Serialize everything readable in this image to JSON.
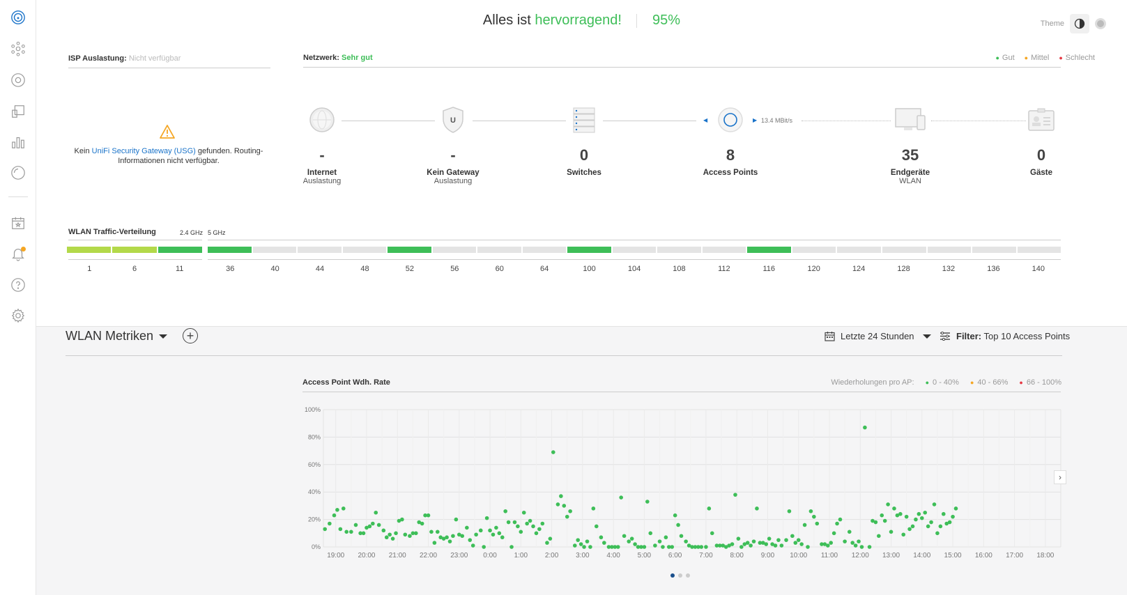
{
  "header": {
    "headline_prefix": "Alles ist",
    "headline_status": "hervorragend!",
    "score": "95%",
    "theme_label": "Theme"
  },
  "isp": {
    "title": "ISP Auslastung:",
    "value": "Nicht verfügbar",
    "msg_prefix": "Kein",
    "msg_link": "UniFi Security Gateway (USG)",
    "msg_suffix": "gefunden. Routing-Informationen nicht verfügbar."
  },
  "network": {
    "title": "Netzwerk:",
    "status": "Sehr gut",
    "legend": [
      "Gut",
      "Mittel",
      "Schlecht"
    ],
    "speed": "13.4 MBit/s",
    "devices": [
      {
        "num": "-",
        "label": "Internet",
        "sub": "Auslastung"
      },
      {
        "num": "-",
        "label": "Kein Gateway",
        "sub": "Auslastung"
      },
      {
        "num": "0",
        "label": "Switches",
        "sub": ""
      },
      {
        "num": "8",
        "label": "Access Points",
        "sub": ""
      },
      {
        "num": "35",
        "label": "Endgeräte",
        "sub": "WLAN"
      },
      {
        "num": "0",
        "label": "Gäste",
        "sub": ""
      }
    ]
  },
  "wlan_traffic": {
    "title": "WLAN Traffic-Verteilung",
    "band_24": "2.4 GHz",
    "band_5": "5 GHz",
    "channels_24": [
      {
        "ch": "1",
        "level": "medium"
      },
      {
        "ch": "6",
        "level": "medium"
      },
      {
        "ch": "11",
        "level": "good"
      }
    ],
    "channels_5": [
      {
        "ch": "36",
        "level": "good"
      },
      {
        "ch": "40",
        "level": "none"
      },
      {
        "ch": "44",
        "level": "none"
      },
      {
        "ch": "48",
        "level": "none"
      },
      {
        "ch": "52",
        "level": "good"
      },
      {
        "ch": "56",
        "level": "none"
      },
      {
        "ch": "60",
        "level": "none"
      },
      {
        "ch": "64",
        "level": "none"
      },
      {
        "ch": "100",
        "level": "good"
      },
      {
        "ch": "104",
        "level": "none"
      },
      {
        "ch": "108",
        "level": "none"
      },
      {
        "ch": "112",
        "level": "none"
      },
      {
        "ch": "116",
        "level": "good"
      },
      {
        "ch": "120",
        "level": "none"
      },
      {
        "ch": "124",
        "level": "none"
      },
      {
        "ch": "128",
        "level": "none"
      },
      {
        "ch": "132",
        "level": "none"
      },
      {
        "ch": "136",
        "level": "none"
      },
      {
        "ch": "140",
        "level": "none"
      }
    ]
  },
  "metrics": {
    "title": "WLAN Metriken",
    "range": "Letzte 24 Stunden",
    "filter_label": "Filter:",
    "filter_value": "Top 10 Access Points"
  },
  "colors": {
    "good": "#3ebe58",
    "medium": "#b3d94a",
    "none": "#e4e4e4",
    "accent": "#1a73c9"
  },
  "chart_data": {
    "type": "scatter",
    "title": "Access Point Wdh. Rate",
    "legend_title": "Wiederholungen pro AP:",
    "legend": [
      {
        "name": "0 - 40%",
        "color": "#3ebe58"
      },
      {
        "name": "40 - 66%",
        "color": "#f5a623"
      },
      {
        "name": "66 - 100%",
        "color": "#e63a45"
      }
    ],
    "x_ticks": [
      "19:00",
      "20:00",
      "21:00",
      "22:00",
      "23:00",
      "0:00",
      "1:00",
      "2:00",
      "3:00",
      "4:00",
      "5:00",
      "6:00",
      "7:00",
      "8:00",
      "9:00",
      "10:00",
      "11:00",
      "12:00",
      "13:00",
      "14:00",
      "15:00",
      "16:00",
      "17:00",
      "18:00"
    ],
    "y_ticks": [
      "0%",
      "20%",
      "40%",
      "60%",
      "80%",
      "100%"
    ],
    "ylim": [
      0,
      100
    ],
    "xlim": [
      18.6,
      42.5
    ],
    "points": [
      [
        18.65,
        13
      ],
      [
        18.8,
        17
      ],
      [
        18.95,
        23
      ],
      [
        19.05,
        27
      ],
      [
        19.15,
        13
      ],
      [
        19.25,
        28
      ],
      [
        19.35,
        11
      ],
      [
        19.5,
        11
      ],
      [
        19.65,
        16
      ],
      [
        19.8,
        10
      ],
      [
        19.9,
        10
      ],
      [
        20.0,
        14
      ],
      [
        20.1,
        15
      ],
      [
        20.2,
        17
      ],
      [
        20.3,
        25
      ],
      [
        20.4,
        16
      ],
      [
        20.55,
        12
      ],
      [
        20.65,
        7
      ],
      [
        20.75,
        9
      ],
      [
        20.85,
        6
      ],
      [
        20.95,
        10
      ],
      [
        21.05,
        19
      ],
      [
        21.15,
        20
      ],
      [
        21.25,
        9
      ],
      [
        21.4,
        8
      ],
      [
        21.5,
        10
      ],
      [
        21.6,
        10
      ],
      [
        21.7,
        18
      ],
      [
        21.8,
        17
      ],
      [
        21.9,
        23
      ],
      [
        22.0,
        23
      ],
      [
        22.1,
        11
      ],
      [
        22.2,
        3
      ],
      [
        22.3,
        11
      ],
      [
        22.4,
        7
      ],
      [
        22.5,
        6
      ],
      [
        22.6,
        7
      ],
      [
        22.7,
        4
      ],
      [
        22.8,
        8
      ],
      [
        22.9,
        20
      ],
      [
        23.0,
        9
      ],
      [
        23.1,
        8
      ],
      [
        23.25,
        14
      ],
      [
        23.35,
        5
      ],
      [
        23.45,
        1
      ],
      [
        23.55,
        9
      ],
      [
        23.7,
        12
      ],
      [
        23.8,
        0
      ],
      [
        23.9,
        21
      ],
      [
        24.0,
        12
      ],
      [
        24.1,
        9
      ],
      [
        24.2,
        14
      ],
      [
        24.3,
        10
      ],
      [
        24.4,
        7
      ],
      [
        24.5,
        26
      ],
      [
        24.6,
        18
      ],
      [
        24.7,
        0
      ],
      [
        24.8,
        18
      ],
      [
        24.9,
        15
      ],
      [
        25.0,
        11
      ],
      [
        25.1,
        25
      ],
      [
        25.2,
        17
      ],
      [
        25.3,
        19
      ],
      [
        25.4,
        15
      ],
      [
        25.5,
        10
      ],
      [
        25.6,
        13
      ],
      [
        25.7,
        17
      ],
      [
        25.85,
        3
      ],
      [
        25.95,
        6
      ],
      [
        26.05,
        69
      ],
      [
        26.2,
        31
      ],
      [
        26.3,
        37
      ],
      [
        26.4,
        30
      ],
      [
        26.5,
        22
      ],
      [
        26.6,
        26
      ],
      [
        26.75,
        1
      ],
      [
        26.85,
        5
      ],
      [
        26.95,
        2
      ],
      [
        27.05,
        0
      ],
      [
        27.15,
        4
      ],
      [
        27.25,
        0
      ],
      [
        27.35,
        28
      ],
      [
        27.45,
        15
      ],
      [
        27.6,
        7
      ],
      [
        27.7,
        3
      ],
      [
        27.85,
        0
      ],
      [
        27.95,
        0
      ],
      [
        28.05,
        0
      ],
      [
        28.15,
        0
      ],
      [
        28.25,
        36
      ],
      [
        28.35,
        8
      ],
      [
        28.5,
        4
      ],
      [
        28.6,
        6
      ],
      [
        28.7,
        2
      ],
      [
        28.8,
        0
      ],
      [
        28.9,
        0
      ],
      [
        29.0,
        0
      ],
      [
        29.1,
        33
      ],
      [
        29.2,
        10
      ],
      [
        29.35,
        1
      ],
      [
        29.5,
        4
      ],
      [
        29.6,
        0
      ],
      [
        29.7,
        7
      ],
      [
        29.8,
        0
      ],
      [
        29.9,
        0
      ],
      [
        30.0,
        23
      ],
      [
        30.1,
        16
      ],
      [
        30.2,
        8
      ],
      [
        30.35,
        4
      ],
      [
        30.45,
        1
      ],
      [
        30.55,
        0
      ],
      [
        30.65,
        0
      ],
      [
        30.75,
        0
      ],
      [
        30.85,
        0
      ],
      [
        31.0,
        0
      ],
      [
        31.1,
        28
      ],
      [
        31.2,
        10
      ],
      [
        31.35,
        1
      ],
      [
        31.45,
        1
      ],
      [
        31.55,
        1
      ],
      [
        31.65,
        0
      ],
      [
        31.75,
        1
      ],
      [
        31.85,
        2
      ],
      [
        31.95,
        38
      ],
      [
        32.05,
        6
      ],
      [
        32.15,
        0
      ],
      [
        32.25,
        2
      ],
      [
        32.35,
        3
      ],
      [
        32.45,
        1
      ],
      [
        32.55,
        4
      ],
      [
        32.65,
        28
      ],
      [
        32.75,
        3
      ],
      [
        32.85,
        3
      ],
      [
        32.95,
        2
      ],
      [
        33.05,
        6
      ],
      [
        33.15,
        2
      ],
      [
        33.25,
        1
      ],
      [
        33.35,
        5
      ],
      [
        33.45,
        1
      ],
      [
        33.6,
        5
      ],
      [
        33.7,
        26
      ],
      [
        33.8,
        8
      ],
      [
        33.9,
        3
      ],
      [
        34.0,
        5
      ],
      [
        34.1,
        2
      ],
      [
        34.2,
        16
      ],
      [
        34.3,
        0
      ],
      [
        34.4,
        26
      ],
      [
        34.5,
        22
      ],
      [
        34.6,
        17
      ],
      [
        34.75,
        2
      ],
      [
        34.85,
        2
      ],
      [
        34.95,
        1
      ],
      [
        35.05,
        3
      ],
      [
        35.15,
        10
      ],
      [
        35.25,
        17
      ],
      [
        35.35,
        20
      ],
      [
        35.5,
        4
      ],
      [
        35.65,
        11
      ],
      [
        35.75,
        3
      ],
      [
        35.85,
        1
      ],
      [
        35.95,
        4
      ],
      [
        36.05,
        0
      ],
      [
        36.15,
        87
      ],
      [
        36.3,
        0
      ],
      [
        36.4,
        19
      ],
      [
        36.5,
        18
      ],
      [
        36.6,
        8
      ],
      [
        36.7,
        23
      ],
      [
        36.8,
        19
      ],
      [
        36.9,
        31
      ],
      [
        37.0,
        11
      ],
      [
        37.1,
        28
      ],
      [
        37.2,
        23
      ],
      [
        37.3,
        24
      ],
      [
        37.4,
        9
      ],
      [
        37.5,
        22
      ],
      [
        37.6,
        13
      ],
      [
        37.7,
        15
      ],
      [
        37.8,
        20
      ],
      [
        37.9,
        24
      ],
      [
        38.0,
        21
      ],
      [
        38.1,
        25
      ],
      [
        38.2,
        15
      ],
      [
        38.3,
        18
      ],
      [
        38.4,
        31
      ],
      [
        38.5,
        10
      ],
      [
        38.6,
        15
      ],
      [
        38.7,
        24
      ],
      [
        38.8,
        17
      ],
      [
        38.9,
        18
      ],
      [
        39.0,
        22
      ],
      [
        39.1,
        28
      ]
    ]
  }
}
